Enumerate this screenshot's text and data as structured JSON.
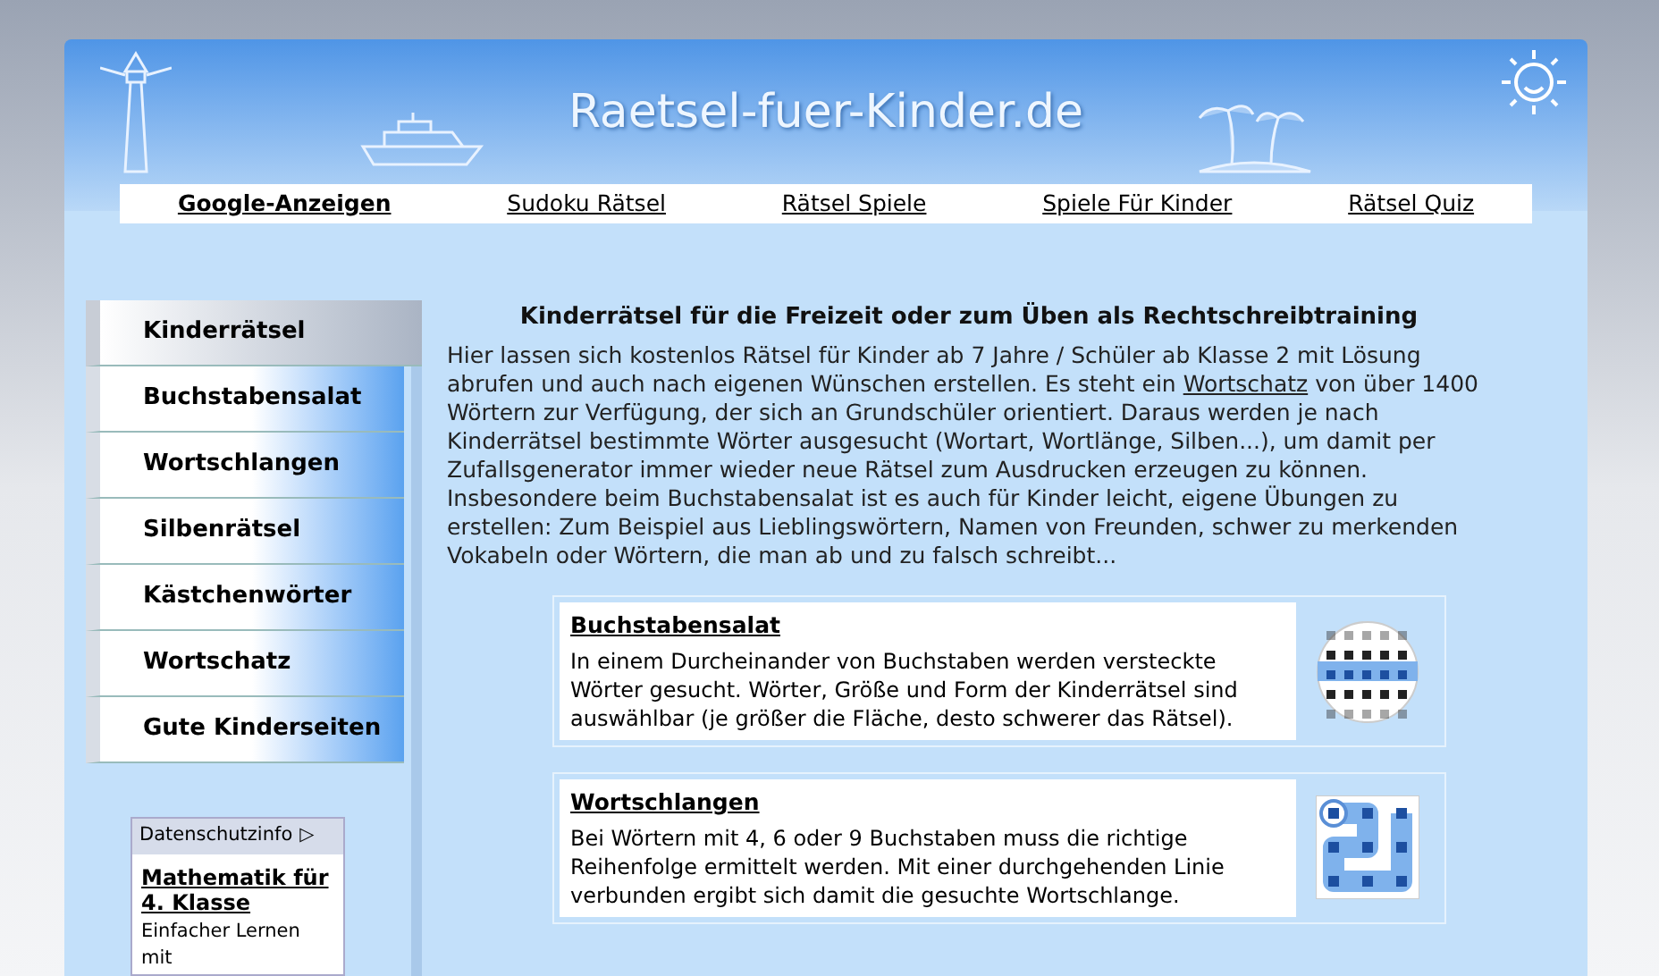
{
  "site_title": "Raetsel-fuer-Kinder.de",
  "nav": [
    {
      "label": "Google-Anzeigen",
      "kind": "ads"
    },
    {
      "label": "Sudoku Rätsel",
      "kind": "link"
    },
    {
      "label": "Rätsel Spiele",
      "kind": "link"
    },
    {
      "label": "Spiele Für Kinder",
      "kind": "link"
    },
    {
      "label": "Rätsel Quiz",
      "kind": "link"
    }
  ],
  "sidebar": {
    "items": [
      {
        "label": "Kinderrätsel",
        "selected": true
      },
      {
        "label": "Buchstabensalat",
        "selected": false
      },
      {
        "label": "Wortschlangen",
        "selected": false
      },
      {
        "label": "Silbenrätsel",
        "selected": false
      },
      {
        "label": "Kästchenwörter",
        "selected": false
      },
      {
        "label": "Wortschatz",
        "selected": false
      },
      {
        "label": "Gute Kinderseiten",
        "selected": false
      }
    ],
    "ad": {
      "privacy": "Datenschutzinfo",
      "arrow": "▷",
      "title": "Mathematik für 4. Klasse",
      "text": "Einfacher Lernen mit"
    }
  },
  "main": {
    "heading": "Kinderrätsel für die Freizeit oder zum Üben als Rechtschreibtraining",
    "intro_before": "Hier lassen sich kostenlos Rätsel für Kinder ab 7 Jahre / Schüler ab Klasse 2 mit Lösung abrufen und auch nach eigenen Wünschen erstellen. Es steht ein",
    "intro_link": "Wortschatz",
    "intro_after": "von über 1400 Wörtern zur Verfügung, der sich an Grundschüler orientiert. Daraus werden je nach Kinderrätsel bestimmte Wörter ausgesucht (Wortart, Wortlänge, Silben...), um damit per Zufallsgenerator immer wieder neue Rätsel zum Ausdrucken erzeugen zu können. Insbesondere beim Buchstabensalat ist es auch für Kinder leicht, eigene Übungen zu erstellen: Zum Beispiel aus Lieblingswörtern, Namen von Freunden, schwer zu merkenden Vokabeln oder Wörtern, die man ab und zu falsch schreibt...",
    "cards": [
      {
        "title": "Buchstabensalat",
        "text": "In einem Durcheinander von Buchstaben werden versteckte Wörter gesucht. Wörter, Größe und Form der Kinderrätsel sind auswählbar (je größer die Fläche, desto schwerer das Rätsel).",
        "kind": "grid"
      },
      {
        "title": "Wortschlangen",
        "text": "Bei Wörtern mit 4, 6 oder 9 Buchstaben muss die richtige Reihenfolge ermittelt werden. Mit einer durchgehenden Linie verbunden ergibt sich damit die gesuchte Wortschlange.",
        "kind": "snake"
      }
    ]
  }
}
